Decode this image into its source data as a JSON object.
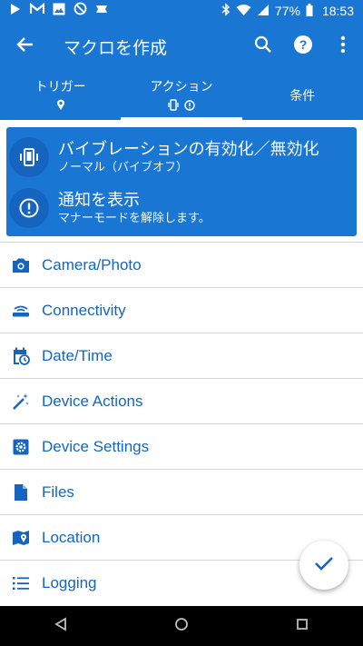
{
  "colors": {
    "primary": "#1976d2",
    "primary_dark": "#1565c0",
    "text_blue": "#1565c0",
    "divider": "#d6d6d6",
    "nav_bar": "#000000"
  },
  "status_bar": {
    "left_icons": [
      "play-icon",
      "gmail-icon",
      "image-icon",
      "do-not-disturb-icon",
      "tasker-icon"
    ],
    "right_icons": [
      "bluetooth-icon",
      "wifi-icon",
      "signal-icon"
    ],
    "battery": "77%",
    "time": "18:53"
  },
  "app_bar": {
    "title": "マクロを作成",
    "icons": [
      "back-arrow-icon",
      "search-icon",
      "help-icon",
      "more-vert-icon"
    ]
  },
  "tabs": [
    {
      "label": "トリガー",
      "active": false
    },
    {
      "label": "アクション",
      "active": true
    },
    {
      "label": "条件",
      "active": false
    }
  ],
  "added_actions": [
    {
      "icon": "vibrate-icon",
      "title": "バイブレーションの有効化／無効化",
      "subtitle": "ノーマル（バイブオフ）"
    },
    {
      "icon": "alert-circle-icon",
      "title": "通知を表示",
      "subtitle": "マナーモードを解除します。"
    }
  ],
  "categories": [
    {
      "icon": "camera-icon",
      "label": "Camera/Photo"
    },
    {
      "icon": "connectivity-icon",
      "label": "Connectivity"
    },
    {
      "icon": "calendar-clock-icon",
      "label": "Date/Time"
    },
    {
      "icon": "magic-wand-icon",
      "label": "Device Actions"
    },
    {
      "icon": "settings-gear-icon",
      "label": "Device Settings"
    },
    {
      "icon": "file-icon",
      "label": "Files"
    },
    {
      "icon": "map-location-icon",
      "label": "Location"
    },
    {
      "icon": "list-icon",
      "label": "Logging"
    }
  ],
  "fab": {
    "icon": "check-icon"
  },
  "nav_bar": {
    "icons": [
      "back-triangle-icon",
      "home-circle-icon",
      "recents-square-icon"
    ]
  }
}
